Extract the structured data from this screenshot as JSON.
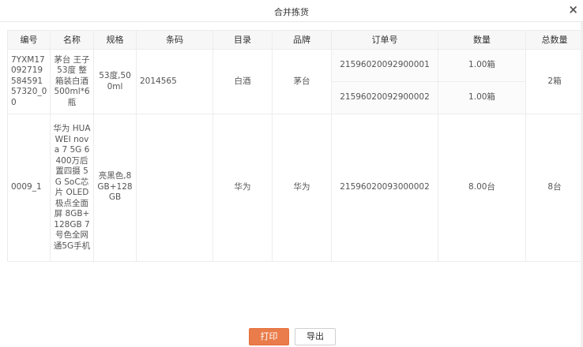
{
  "dialog": {
    "title": "合并拣货",
    "close_icon": "close-icon",
    "close_glyph": "×"
  },
  "table": {
    "headers": [
      "编号",
      "名称",
      "规格",
      "条码",
      "目录",
      "品牌",
      "订单号",
      "数量",
      "总数量"
    ],
    "groups": [
      {
        "code": "7YXM1709271958459157320_00",
        "name": "茅台 王子 53度 整箱装白酒 500ml*6瓶",
        "spec": "53度,500ml",
        "barcode": "2014565",
        "catalog": "白酒",
        "brand": "茅台",
        "orders": [
          {
            "order_no": "21596020092900001",
            "qty": "1.00箱"
          },
          {
            "order_no": "21596020092900002",
            "qty": "1.00箱"
          }
        ],
        "total": "2箱"
      },
      {
        "code": "0009_1",
        "name": "华为 HUAWEI nova 7 5G 6400万后置四摄 5G SoC芯片 OLED极点全面屏 8GB+128GB 7号色全网通5G手机",
        "spec": "亮黑色,8GB+128GB",
        "barcode": "",
        "catalog": "华为",
        "brand": "华为",
        "orders": [
          {
            "order_no": "21596020093000002",
            "qty": "8.00台"
          }
        ],
        "total": "8台"
      }
    ]
  },
  "footer": {
    "print_label": "打印",
    "export_label": "导出"
  }
}
